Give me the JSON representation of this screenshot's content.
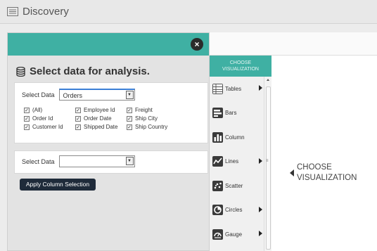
{
  "app": {
    "title": "Discovery"
  },
  "panel": {
    "heading": "Select data for analysis.",
    "close_label": "×",
    "select1": {
      "label": "Select Data",
      "value": "Orders",
      "columns": [
        [
          "(All)",
          "Employee Id",
          "Freight"
        ],
        [
          "Order Id",
          "Order Date",
          "Ship City"
        ],
        [
          "Customer Id",
          "Shipped Date",
          "Ship Country"
        ]
      ]
    },
    "select2": {
      "label": "Select Data",
      "value": ""
    },
    "apply_button": "Apply Column Selection"
  },
  "visualization": {
    "header_line1": "CHOOSE",
    "header_line2": "VISUALIZATION",
    "items": [
      {
        "label": "Tables",
        "icon": "table-icon",
        "submenu": true
      },
      {
        "label": "Bars",
        "icon": "bar-chart-icon",
        "submenu": false
      },
      {
        "label": "Column",
        "icon": "column-chart-icon",
        "submenu": false
      },
      {
        "label": "Lines",
        "icon": "line-chart-icon",
        "submenu": true
      },
      {
        "label": "Scatter",
        "icon": "scatter-icon",
        "submenu": false
      },
      {
        "label": "Circles",
        "icon": "circle-chart-icon",
        "submenu": true
      },
      {
        "label": "Gauge",
        "icon": "gauge-icon",
        "submenu": true
      }
    ],
    "placeholder_line1": "CHOOSE",
    "placeholder_line2": "VISUALIZATION"
  },
  "colors": {
    "accent": "#3fb0a3",
    "button_dark": "#1f2b3a"
  }
}
